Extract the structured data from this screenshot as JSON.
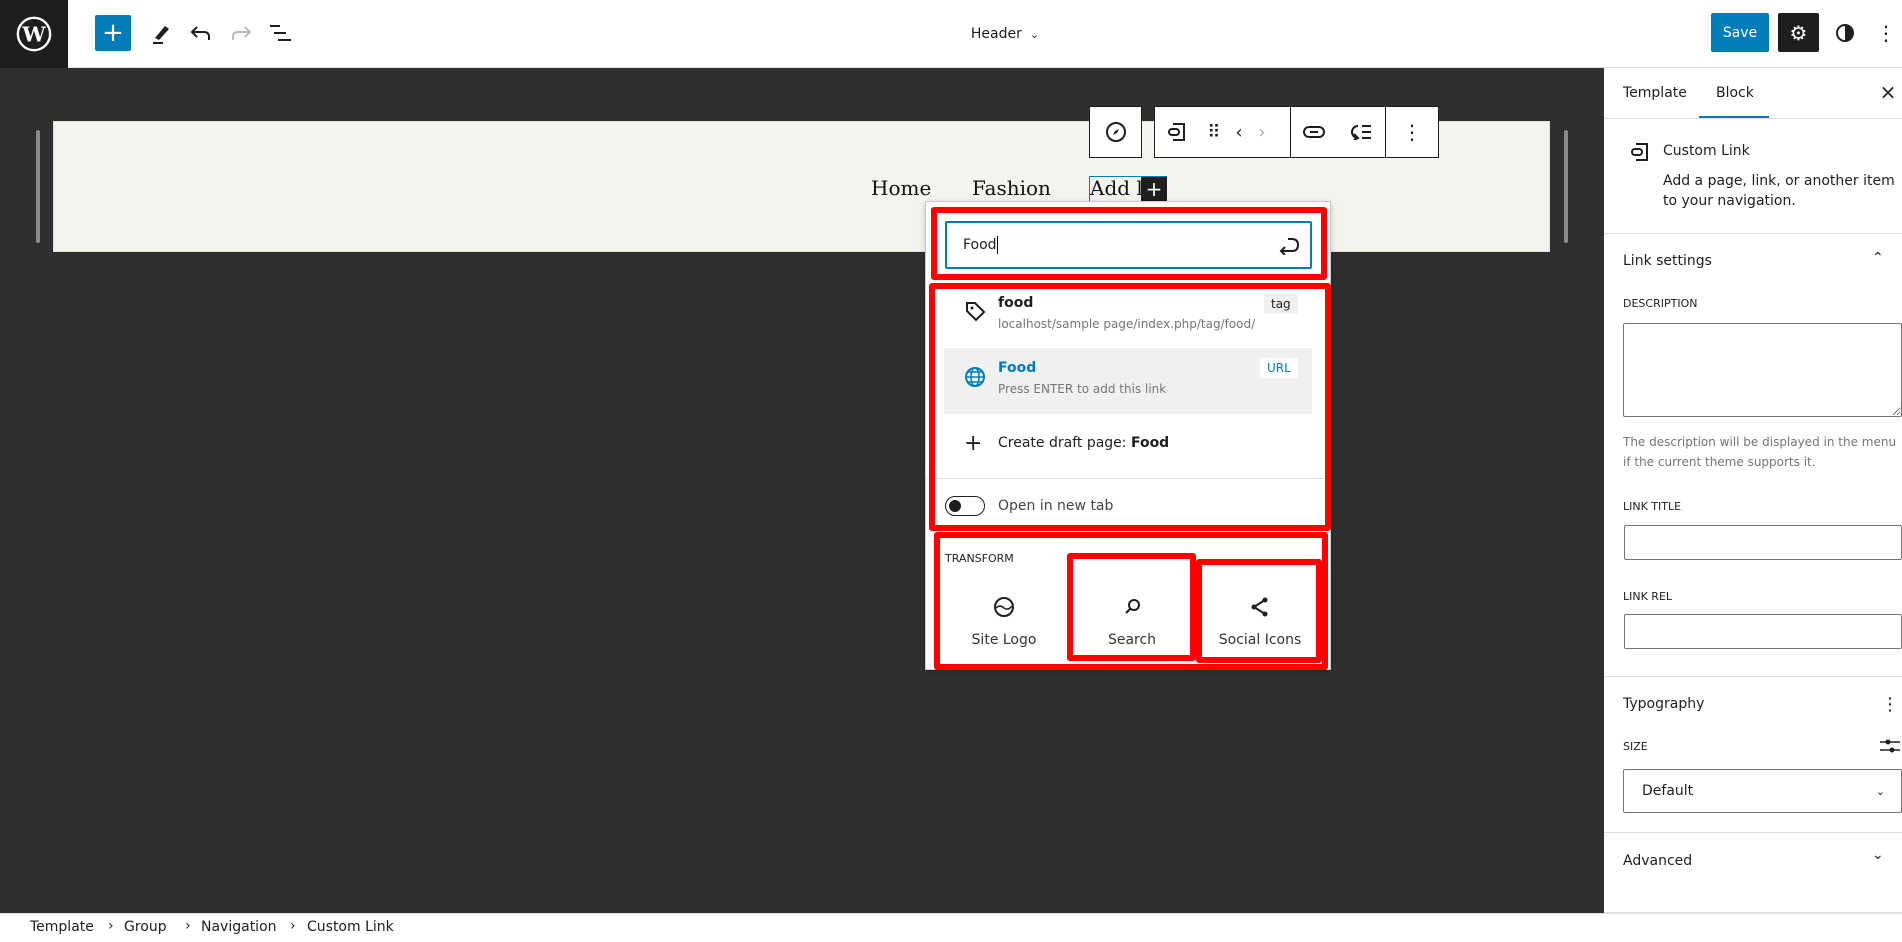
{
  "topbar": {
    "title": "Header",
    "save": "Save",
    "colors": {
      "accent": "#007cba"
    }
  },
  "canvas": {
    "nav_items": [
      "Home",
      "Fashion",
      "Add link"
    ]
  },
  "popover": {
    "search_value": "Food",
    "results": [
      {
        "title": "food",
        "subtitle": "localhost/sample page/index.php/tag/food/",
        "badge": "tag",
        "icon": "tag-icon"
      },
      {
        "title": "Food",
        "subtitle": "Press ENTER to add this link",
        "badge": "URL",
        "icon": "globe-icon"
      }
    ],
    "create_prefix": "Create draft page: ",
    "create_name": "Food",
    "toggle_label": "Open in new tab",
    "toggle_on": false,
    "transform_label": "TRANSFORM",
    "transforms": [
      "Site Logo",
      "Search",
      "Social Icons"
    ]
  },
  "sidebar": {
    "tabs": [
      "Template",
      "Block"
    ],
    "active_tab": "Block",
    "block_title": "Custom Link",
    "block_desc": "Add a page, link, or another item to your navigation.",
    "link_settings": "Link settings",
    "description_label": "DESCRIPTION",
    "description_help": "The description will be displayed in the menu if the current theme supports it.",
    "link_title_label": "LINK TITLE",
    "link_rel_label": "LINK REL",
    "typography": "Typography",
    "size_label": "SIZE",
    "size_value": "Default",
    "advanced": "Advanced"
  },
  "breadcrumb": [
    "Template",
    "Group",
    "Navigation",
    "Custom Link"
  ]
}
